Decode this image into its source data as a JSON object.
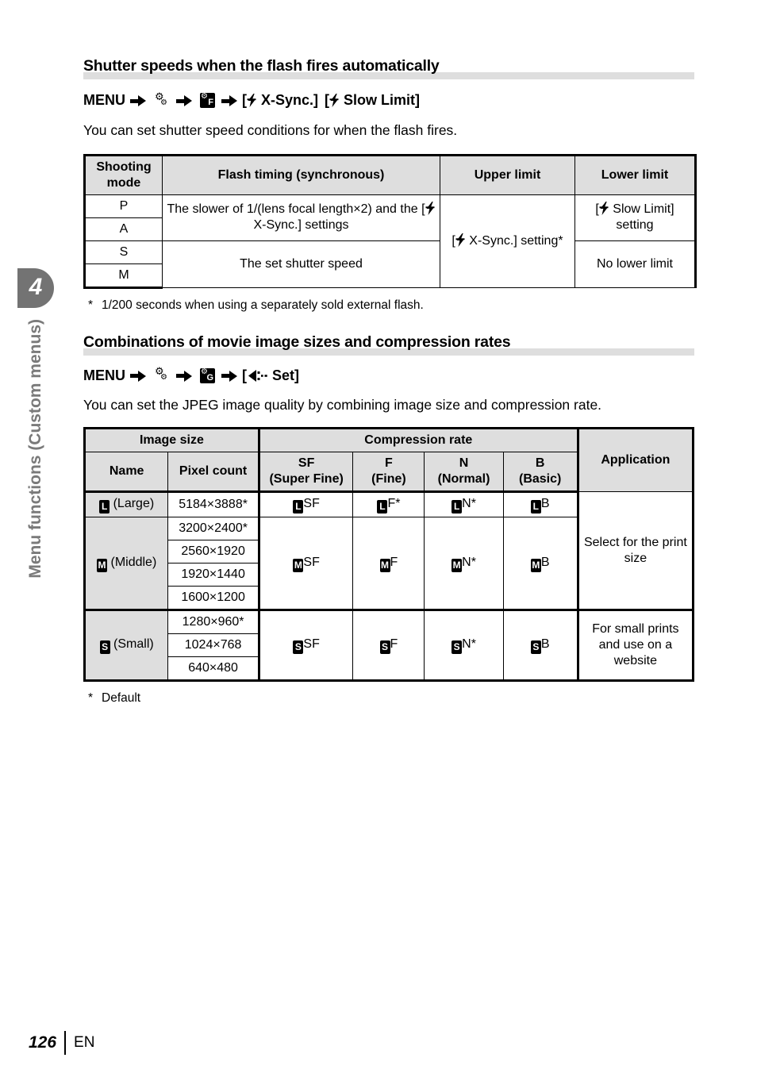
{
  "page": {
    "number": "126",
    "language": "EN",
    "chapter_number": "4",
    "chapter_title": "Menu functions (Custom menus)"
  },
  "section1": {
    "heading": "Shutter speeds when the flash fires automatically",
    "menu_path": {
      "menu_label": "MENU",
      "arrow_icon": "right-arrow-icon",
      "gears_icon": "custom-menu-gears-icon",
      "tab_icon_letter": "F",
      "bracket_open": "[",
      "flash_icon": "flash-bolt-icon",
      "item1": "X-Sync.]",
      "bracket_open2": "[",
      "item2": "Slow Limit]"
    },
    "intro": "You can set shutter speed conditions for when the flash fires.",
    "table": {
      "headers": [
        "Shooting mode",
        "Flash timing (synchronous)",
        "Upper limit",
        "Lower limit"
      ],
      "modes": [
        "P",
        "A",
        "S",
        "M"
      ],
      "flash_timing_pa": "The slower of 1/(lens focal length×2) and the [",
      "flash_timing_pa_suffix": " X-Sync.] settings",
      "flash_timing_sm": "The set shutter speed",
      "upper_limit_prefix": "[",
      "upper_limit_suffix": " X-Sync.] setting*",
      "lower_limit_pa_prefix": "[",
      "lower_limit_pa_suffix": " Slow Limit] setting",
      "lower_limit_sm": "No lower limit"
    },
    "footnote": {
      "marker": "*",
      "text": "1/200 seconds when using a separately sold external flash."
    }
  },
  "section2": {
    "heading": "Combinations of movie image sizes and compression rates",
    "menu_path": {
      "menu_label": "MENU",
      "arrow_icon": "right-arrow-icon",
      "gears_icon": "custom-menu-gears-icon",
      "tab_icon_letter": "G",
      "bracket_open": "[",
      "quality_icon": "image-quality-icon",
      "item1": "Set]"
    },
    "intro": "You can set the JPEG image quality by combining image size and compression rate.",
    "table": {
      "group_headers": {
        "image_size": "Image size",
        "compression_rate": "Compression rate",
        "application": "Application"
      },
      "sub_headers": {
        "name": "Name",
        "pixel_count": "Pixel count",
        "sf_top": "SF",
        "sf_bottom": "(Super Fine)",
        "f_top": "F",
        "f_bottom": "(Fine)",
        "n_top": "N",
        "n_bottom": "(Normal)",
        "b_top": "B",
        "b_bottom": "(Basic)"
      },
      "rows": [
        {
          "badge": "L",
          "name": "(Large)",
          "pixels": [
            "5184×3888*"
          ],
          "sf": "SF",
          "f": "F*",
          "n": "N*",
          "b": "B",
          "application": "Select for the print size"
        },
        {
          "badge": "M",
          "name": "(Middle)",
          "pixels": [
            "3200×2400*",
            "2560×1920",
            "1920×1440",
            "1600×1200"
          ],
          "sf": "SF",
          "f": "F",
          "n": "N*",
          "b": "B",
          "application": ""
        },
        {
          "badge": "S",
          "name": "(Small)",
          "pixels": [
            "1280×960*",
            "1024×768",
            "640×480"
          ],
          "sf": "SF",
          "f": "F",
          "n": "N*",
          "b": "B",
          "application": "For small prints and use on a website"
        }
      ]
    },
    "footnote": {
      "marker": "*",
      "text": "Default"
    }
  }
}
